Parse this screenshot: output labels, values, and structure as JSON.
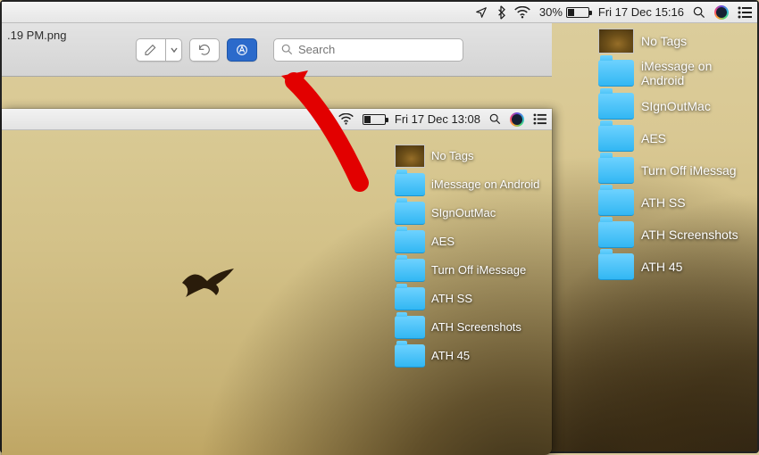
{
  "outer_menubar": {
    "battery_pct": "30%",
    "datetime": "Fri 17 Dec  15:16"
  },
  "inner_menubar": {
    "datetime": "Fri 17 Dec  13:08"
  },
  "toolbar": {
    "filename": ".19 PM.png",
    "search_placeholder": "Search"
  },
  "outer_folders": [
    {
      "kind": "notags",
      "label": "No Tags"
    },
    {
      "kind": "folder",
      "label": "iMessage on Android"
    },
    {
      "kind": "folder",
      "label": "SIgnOutMac"
    },
    {
      "kind": "folder",
      "label": "AES"
    },
    {
      "kind": "folder",
      "label": "Turn Off iMessag"
    },
    {
      "kind": "folder",
      "label": "ATH SS"
    },
    {
      "kind": "folder",
      "label": "ATH Screenshots"
    },
    {
      "kind": "folder",
      "label": "ATH 45"
    }
  ],
  "inner_folders": [
    {
      "kind": "notags",
      "label": "No Tags"
    },
    {
      "kind": "folder",
      "label": "iMessage on Android"
    },
    {
      "kind": "folder",
      "label": "SIgnOutMac"
    },
    {
      "kind": "folder",
      "label": "AES"
    },
    {
      "kind": "folder",
      "label": "Turn Off iMessage"
    },
    {
      "kind": "folder",
      "label": "ATH SS"
    },
    {
      "kind": "folder",
      "label": "ATH Screenshots"
    },
    {
      "kind": "folder",
      "label": "ATH 45"
    }
  ]
}
